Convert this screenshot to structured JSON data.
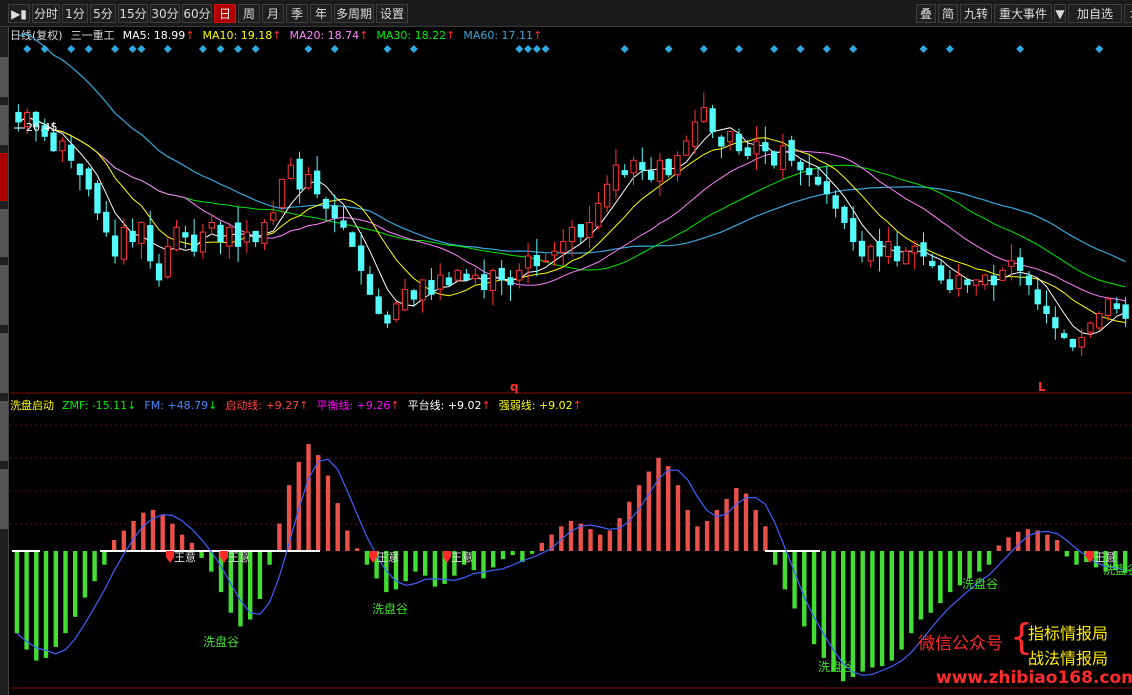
{
  "toolbar": {
    "left_buttons": [
      {
        "label": "分时",
        "active": false
      },
      {
        "label": "1分",
        "active": false
      },
      {
        "label": "5分",
        "active": false
      },
      {
        "label": "15分",
        "active": false
      },
      {
        "label": "30分",
        "active": false
      },
      {
        "label": "60分",
        "active": false
      },
      {
        "label": "日",
        "active": true
      },
      {
        "label": "周",
        "active": false
      },
      {
        "label": "月",
        "active": false
      },
      {
        "label": "季",
        "active": false
      },
      {
        "label": "年",
        "active": false
      },
      {
        "label": "多周期",
        "active": false
      },
      {
        "label": "设置",
        "active": false
      }
    ],
    "right_buttons": [
      "叠",
      "简",
      "九转",
      "重大事件",
      "加自选",
      "均线"
    ]
  },
  "price_legend": {
    "period": "日线(复权)",
    "indicator": "三一重工",
    "ma5": "MA5: 18.99",
    "ma10": "MA10: 19.18",
    "ma20": "MA20: 18.74",
    "ma30": "MA30: 18.22",
    "ma60": "MA60: 17.11",
    "up_arrow": "↑",
    "high_label": "20.45",
    "mark_q": "q",
    "mark_l": "L"
  },
  "osc_legend": {
    "name": "洗盘启动",
    "zmf": "ZMF: -15.11",
    "zmf_arrow": "↓",
    "fm": "FM: +48.79",
    "fm_arrow": "↓",
    "qidong": "启动线: +9.27",
    "pingheng": "平衡线: +9.26",
    "pingtai": "平台线: +9.02",
    "qiangruo": "强弱线: +9.02",
    "arrow": "↑"
  },
  "osc_labels": {
    "washgu": "洗盘谷",
    "wangyi": "王意"
  },
  "watermark": {
    "wechat": "微信公众号",
    "brand1": "指标情报局",
    "brand2": "战法情报局",
    "url": "www.zhibiao168.com"
  },
  "colors": {
    "up_candle": "#ff3232",
    "down_candle": "#54fcfc",
    "ma5": "#ffffff",
    "ma10": "#ffff00",
    "ma20": "#ff80ff",
    "ma30": "#00e600",
    "ma60": "#3aa6d8",
    "osc_pos": "#e8524a",
    "osc_neg": "#44dd33",
    "fm_line": "#4060ff",
    "diamond": "#2fa8e0"
  },
  "chart_data": {
    "type": "candlestick",
    "ylim": [
      14.5,
      21.5
    ],
    "high_marker": 20.45,
    "closes": [
      20.1,
      20.3,
      20.0,
      19.8,
      19.5,
      19.7,
      19.3,
      19.0,
      18.7,
      18.2,
      17.8,
      17.3,
      17.9,
      17.6,
      18.0,
      17.2,
      16.8,
      17.5,
      17.9,
      17.7,
      17.4,
      17.8,
      18.0,
      17.6,
      17.9,
      17.5,
      17.8,
      17.6,
      18.0,
      18.2,
      18.9,
      19.2,
      18.7,
      19.0,
      18.6,
      18.3,
      18.1,
      17.9,
      17.5,
      17.0,
      16.5,
      16.1,
      15.9,
      16.3,
      16.6,
      16.4,
      16.8,
      16.5,
      16.9,
      16.7,
      17.0,
      16.8,
      16.9,
      16.6,
      17.0,
      16.8,
      16.7,
      17.0,
      17.3,
      17.1,
      17.2,
      17.4,
      17.6,
      17.9,
      17.7,
      18.0,
      18.4,
      18.8,
      19.2,
      19.0,
      19.3,
      19.1,
      18.9,
      19.3,
      19.0,
      19.4,
      19.7,
      20.1,
      20.4,
      19.9,
      19.6,
      19.9,
      19.5,
      19.4,
      19.7,
      19.5,
      19.2,
      19.6,
      19.3,
      19.1,
      19.0,
      18.8,
      18.6,
      18.3,
      18.0,
      17.6,
      17.3,
      17.5,
      17.3,
      17.6,
      17.2,
      17.4,
      17.5,
      17.3,
      17.1,
      16.8,
      16.6,
      16.9,
      16.7,
      16.8,
      16.9,
      16.7,
      17.0,
      17.2,
      17.0,
      16.7,
      16.3,
      16.1,
      15.8,
      15.6,
      15.4,
      15.6,
      15.9,
      16.1,
      16.4,
      16.2,
      16.0
    ],
    "osc_values": [
      -60,
      -72,
      -80,
      -78,
      -70,
      -60,
      -48,
      -34,
      -22,
      -10,
      8,
      15,
      22,
      28,
      30,
      26,
      20,
      12,
      6,
      -5,
      -15,
      -30,
      -45,
      -55,
      -50,
      -35,
      -10,
      20,
      48,
      65,
      78,
      70,
      55,
      35,
      15,
      2,
      -10,
      -20,
      -30,
      -28,
      -22,
      -15,
      -18,
      -26,
      -24,
      -18,
      -10,
      -14,
      -20,
      -12,
      -6,
      -3,
      -8,
      -2,
      6,
      12,
      18,
      22,
      20,
      16,
      12,
      15,
      24,
      36,
      48,
      58,
      68,
      62,
      48,
      30,
      18,
      22,
      30,
      38,
      46,
      42,
      30,
      18,
      -10,
      -28,
      -42,
      -55,
      -68,
      -78,
      -88,
      -95,
      -92,
      -88,
      -85,
      -84,
      -80,
      -72,
      -60,
      -50,
      -45,
      -38,
      -30,
      -25,
      -20,
      -15,
      -10,
      4,
      10,
      14,
      16,
      15,
      12,
      8,
      -4,
      -10,
      -8,
      -12,
      -15,
      -14,
      -16
    ]
  }
}
